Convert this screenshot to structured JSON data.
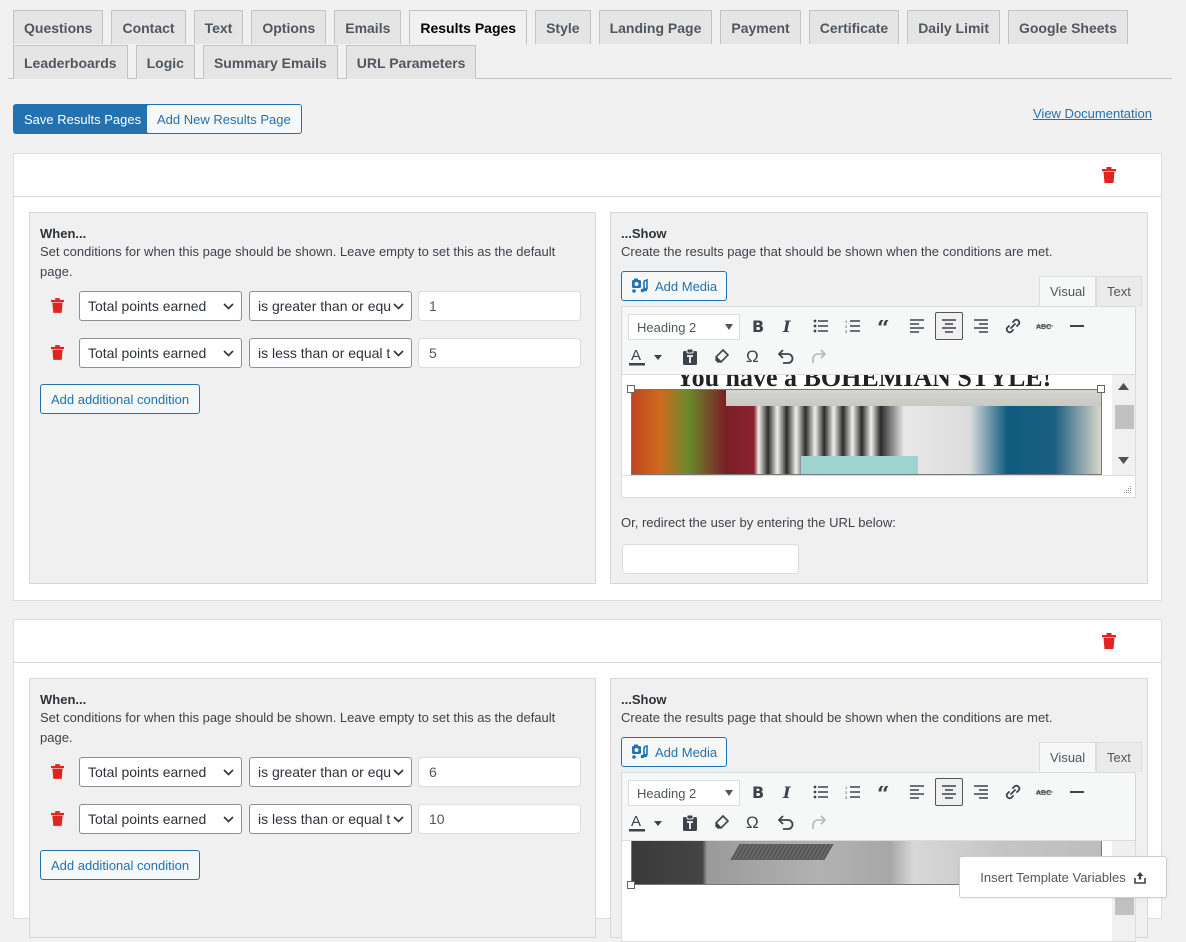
{
  "tabs": {
    "row1": [
      "Questions",
      "Contact",
      "Text",
      "Options",
      "Emails",
      "Results Pages",
      "Style",
      "Landing Page",
      "Payment",
      "Certificate",
      "Daily Limit",
      "Google Sheets"
    ],
    "row2": [
      "Leaderboards",
      "Logic",
      "Summary Emails",
      "URL Parameters"
    ],
    "active": "Results Pages"
  },
  "actions": {
    "save_label": "Save Results Pages",
    "add_label": "Add New Results Page",
    "doc_link": "View Documentation"
  },
  "colors": {
    "primary": "#2271b1",
    "danger": "#e02424",
    "background": "#f1f1f1"
  },
  "result_pages": [
    {
      "when": {
        "title": "When...",
        "description": "Set conditions for when this page should be shown. Leave empty to set this as the default page.",
        "conditions": [
          {
            "field": "Total points earned",
            "operator": "is greater than or equ",
            "value": "1"
          },
          {
            "field": "Total points earned",
            "operator": "is less than or equal t",
            "value": "5"
          }
        ],
        "add_condition_label": "Add additional condition"
      },
      "show": {
        "title": "...Show",
        "description": "Create the results page that should be shown when the conditions are met.",
        "add_media_label": "Add Media",
        "editor_tabs": [
          "Visual",
          "Text"
        ],
        "format_select": "Heading 2",
        "content_heading": "You have a BOHEMIAN STYLE!",
        "redirect_label": "Or, redirect the user by entering the URL below:",
        "redirect_value": ""
      }
    },
    {
      "when": {
        "title": "When...",
        "description": "Set conditions for when this page should be shown. Leave empty to set this as the default page.",
        "conditions": [
          {
            "field": "Total points earned",
            "operator": "is greater than or equ",
            "value": "6"
          },
          {
            "field": "Total points earned",
            "operator": "is less than or equal t",
            "value": "10"
          }
        ],
        "add_condition_label": "Add additional condition"
      },
      "show": {
        "title": "...Show",
        "description": "Create the results page that should be shown when the conditions are met.",
        "add_media_label": "Add Media",
        "editor_tabs": [
          "Visual",
          "Text"
        ],
        "format_select": "Heading 2"
      }
    }
  ],
  "template_vars_label": "Insert Template Variables"
}
